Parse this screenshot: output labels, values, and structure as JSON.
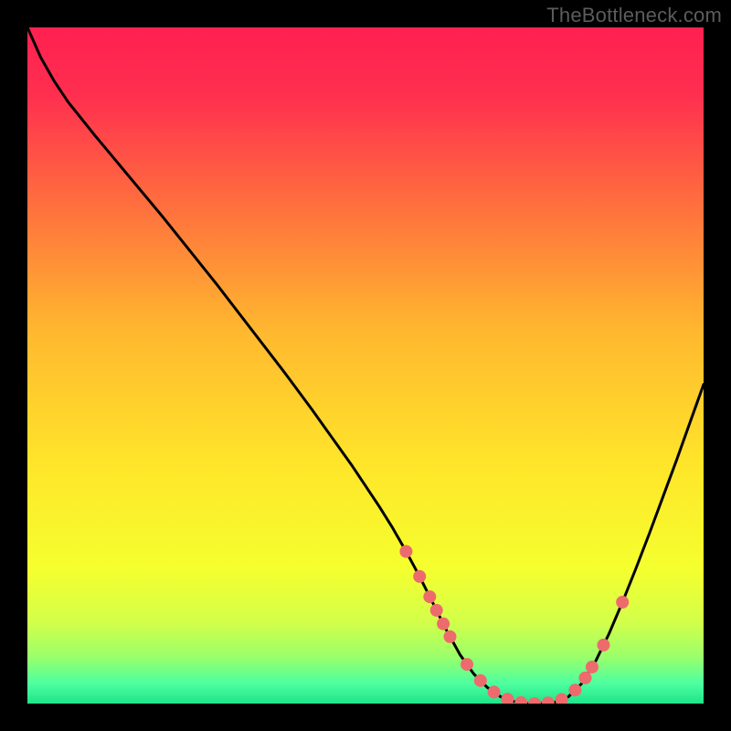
{
  "watermark": "TheBottleneck.com",
  "colors": {
    "frame": "#000000",
    "curve": "#000000",
    "dots": "#ed6b6d",
    "gradient_stops": [
      {
        "offset": 0.0,
        "color": "#ff2050"
      },
      {
        "offset": 0.1,
        "color": "#ff2f4f"
      },
      {
        "offset": 0.25,
        "color": "#ff6a3f"
      },
      {
        "offset": 0.45,
        "color": "#ffb82f"
      },
      {
        "offset": 0.65,
        "color": "#ffe62a"
      },
      {
        "offset": 0.8,
        "color": "#f5ff2e"
      },
      {
        "offset": 0.88,
        "color": "#d2ff4a"
      },
      {
        "offset": 0.93,
        "color": "#9cff6a"
      },
      {
        "offset": 0.97,
        "color": "#4dffa0"
      },
      {
        "offset": 1.0,
        "color": "#1fe48a"
      }
    ]
  },
  "chart_data": {
    "type": "line",
    "x": [
      0.0,
      0.02,
      0.04,
      0.06,
      0.08,
      0.1,
      0.12,
      0.14,
      0.16,
      0.18,
      0.2,
      0.22,
      0.24,
      0.26,
      0.28,
      0.3,
      0.32,
      0.34,
      0.36,
      0.38,
      0.4,
      0.42,
      0.44,
      0.46,
      0.48,
      0.5,
      0.52,
      0.54,
      0.56,
      0.58,
      0.6,
      0.62,
      0.64,
      0.66,
      0.68,
      0.7,
      0.72,
      0.74,
      0.76,
      0.78,
      0.8,
      0.82,
      0.84,
      0.86,
      0.88,
      0.9,
      0.92,
      0.94,
      0.96,
      0.98,
      1.0
    ],
    "y": [
      1.0,
      0.955,
      0.92,
      0.89,
      0.865,
      0.84,
      0.816,
      0.792,
      0.768,
      0.744,
      0.72,
      0.695,
      0.67,
      0.645,
      0.62,
      0.594,
      0.568,
      0.542,
      0.516,
      0.49,
      0.463,
      0.436,
      0.408,
      0.38,
      0.352,
      0.322,
      0.292,
      0.26,
      0.225,
      0.188,
      0.148,
      0.108,
      0.072,
      0.044,
      0.024,
      0.01,
      0.003,
      0.0,
      0.0,
      0.002,
      0.01,
      0.03,
      0.062,
      0.103,
      0.15,
      0.2,
      0.252,
      0.306,
      0.36,
      0.416,
      0.472
    ],
    "dots_x": [
      0.56,
      0.58,
      0.595,
      0.605,
      0.615,
      0.625,
      0.65,
      0.67,
      0.69,
      0.71,
      0.73,
      0.75,
      0.77,
      0.79,
      0.81,
      0.825,
      0.835,
      0.852,
      0.88
    ],
    "xlim": [
      0,
      1
    ],
    "ylim": [
      0,
      1
    ],
    "title": "",
    "xlabel": "",
    "ylabel": ""
  }
}
